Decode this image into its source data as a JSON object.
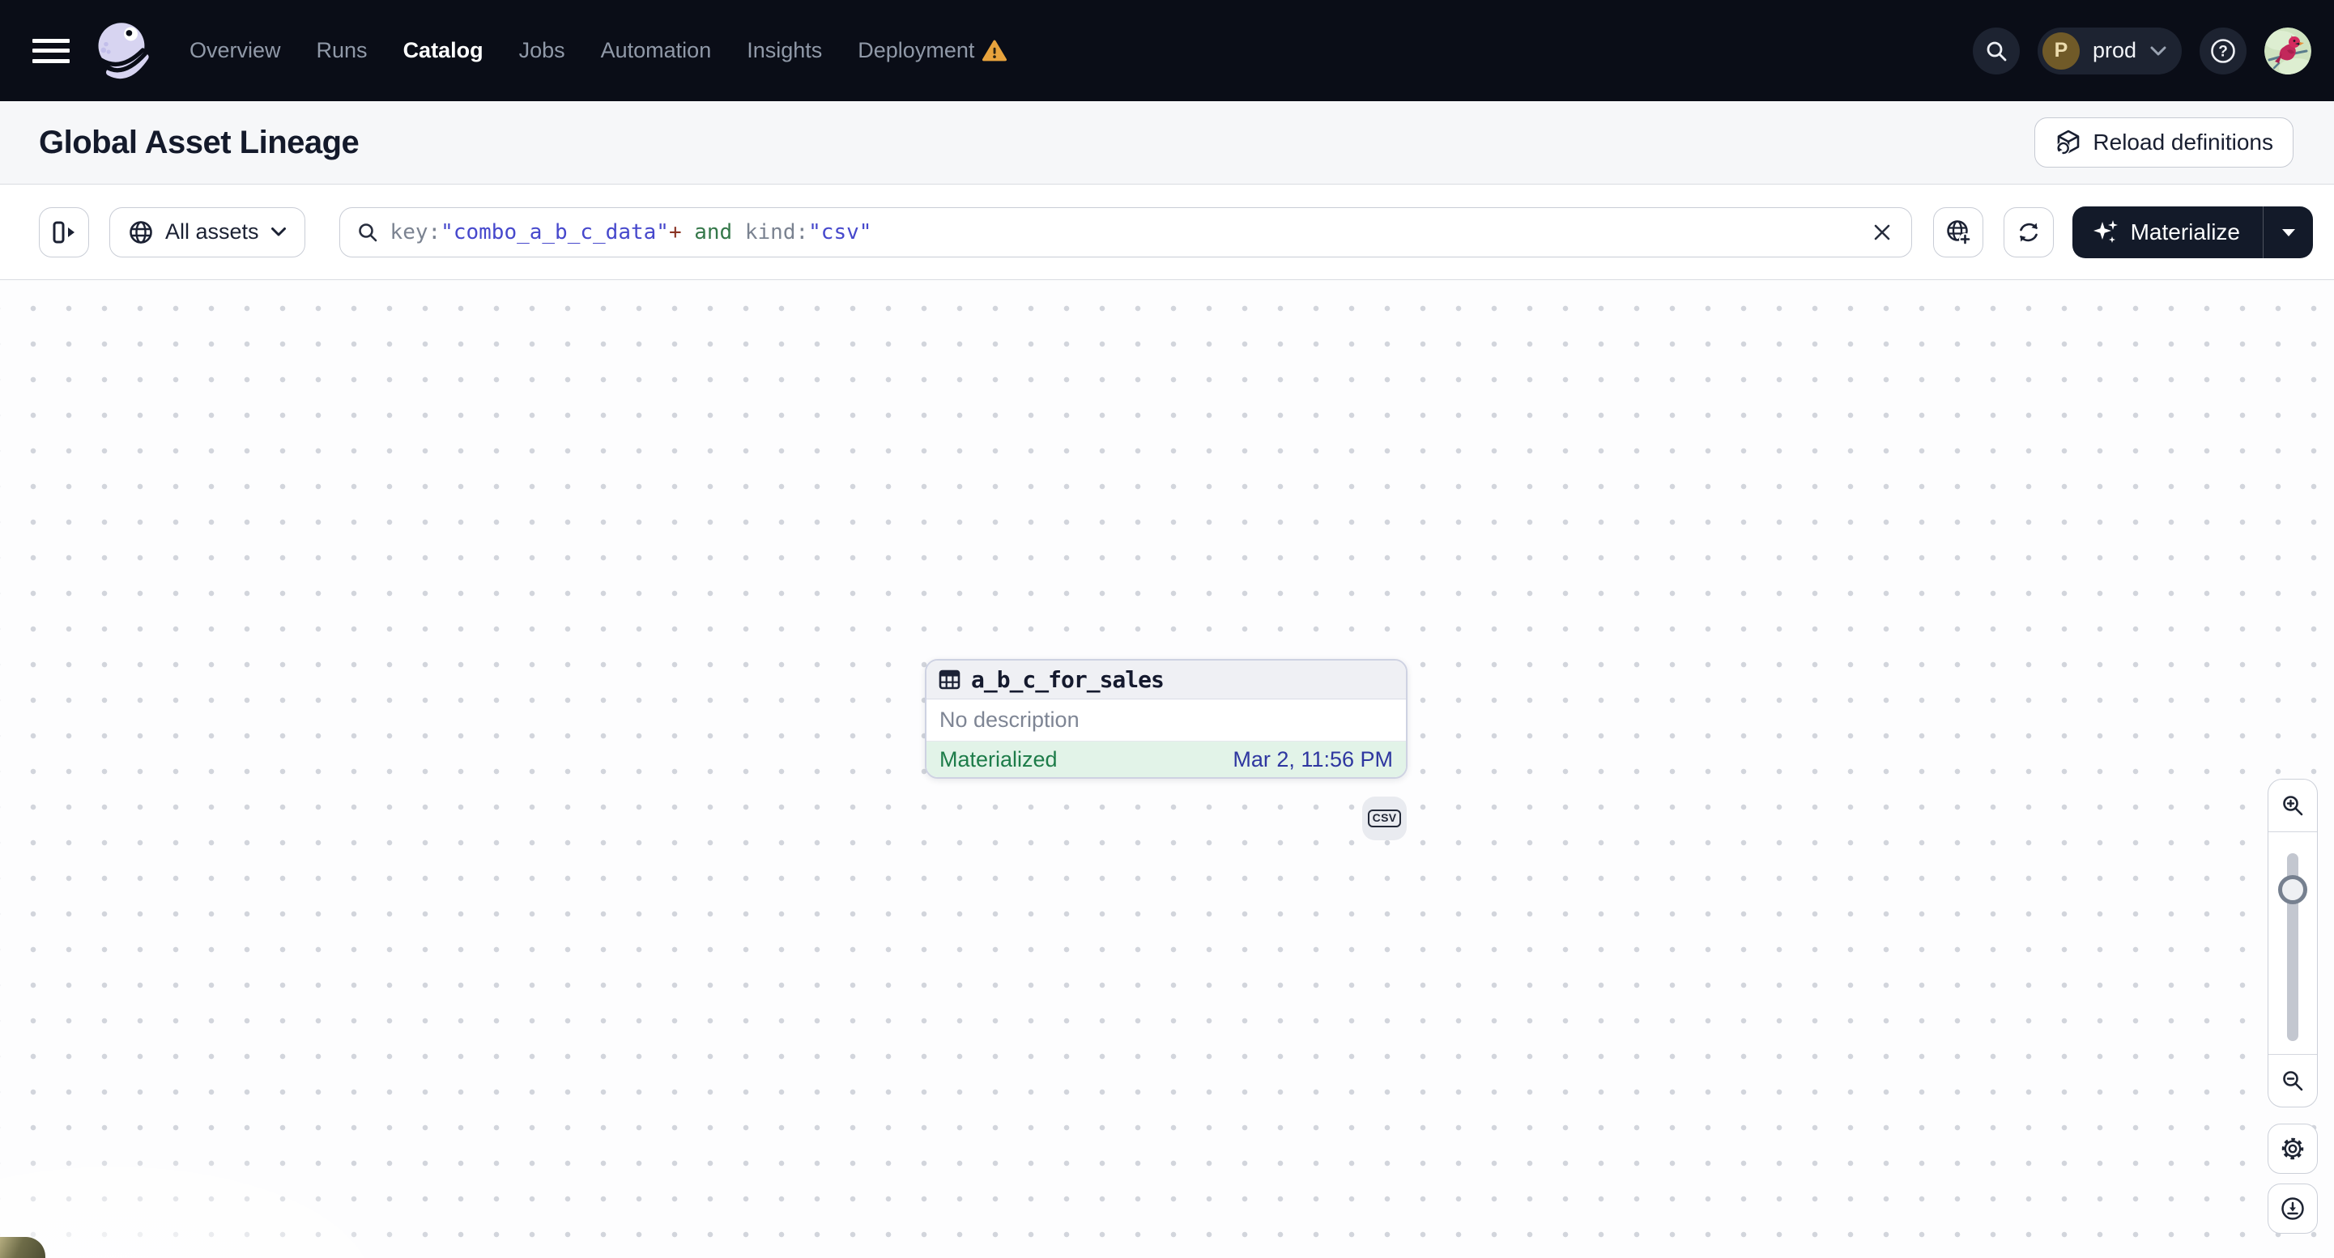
{
  "nav": {
    "items": [
      {
        "label": "Overview"
      },
      {
        "label": "Runs"
      },
      {
        "label": "Catalog"
      },
      {
        "label": "Jobs"
      },
      {
        "label": "Automation"
      },
      {
        "label": "Insights"
      },
      {
        "label": "Deployment"
      }
    ],
    "active_item": "Catalog",
    "deployment_has_warning": true,
    "workspace": {
      "name": "prod",
      "avatar_letter": "P"
    }
  },
  "header": {
    "title": "Global Asset Lineage",
    "reload_button_label": "Reload definitions"
  },
  "toolbar": {
    "scope_label": "All assets",
    "materialize_label": "Materialize",
    "search": {
      "full_query": "key:\"combo_a_b_c_data\"+ and kind:\"csv\"",
      "segments": [
        {
          "text": "key:",
          "kind": "field"
        },
        {
          "text": "\"combo_a_b_c_data\"",
          "kind": "value"
        },
        {
          "text": "+",
          "kind": "operator"
        },
        {
          "text": " and ",
          "kind": "keyword"
        },
        {
          "text": "kind:",
          "kind": "field"
        },
        {
          "text": "\"csv\"",
          "kind": "value"
        }
      ]
    }
  },
  "graph": {
    "node": {
      "title": "a_b_c_for_sales",
      "description": "No description",
      "status": "Materialized",
      "status_time": "Mar 2, 11:56 PM",
      "kind_badge": "CSV"
    }
  },
  "colors": {
    "status_green": "#1d7c49",
    "status_bg_green": "#e2f3e8",
    "timestamp_blue": "#2e36a0",
    "warning_orange": "#e8a33d",
    "nav_bg": "#0a0d17",
    "query_value_indigo": "#4648cc"
  }
}
